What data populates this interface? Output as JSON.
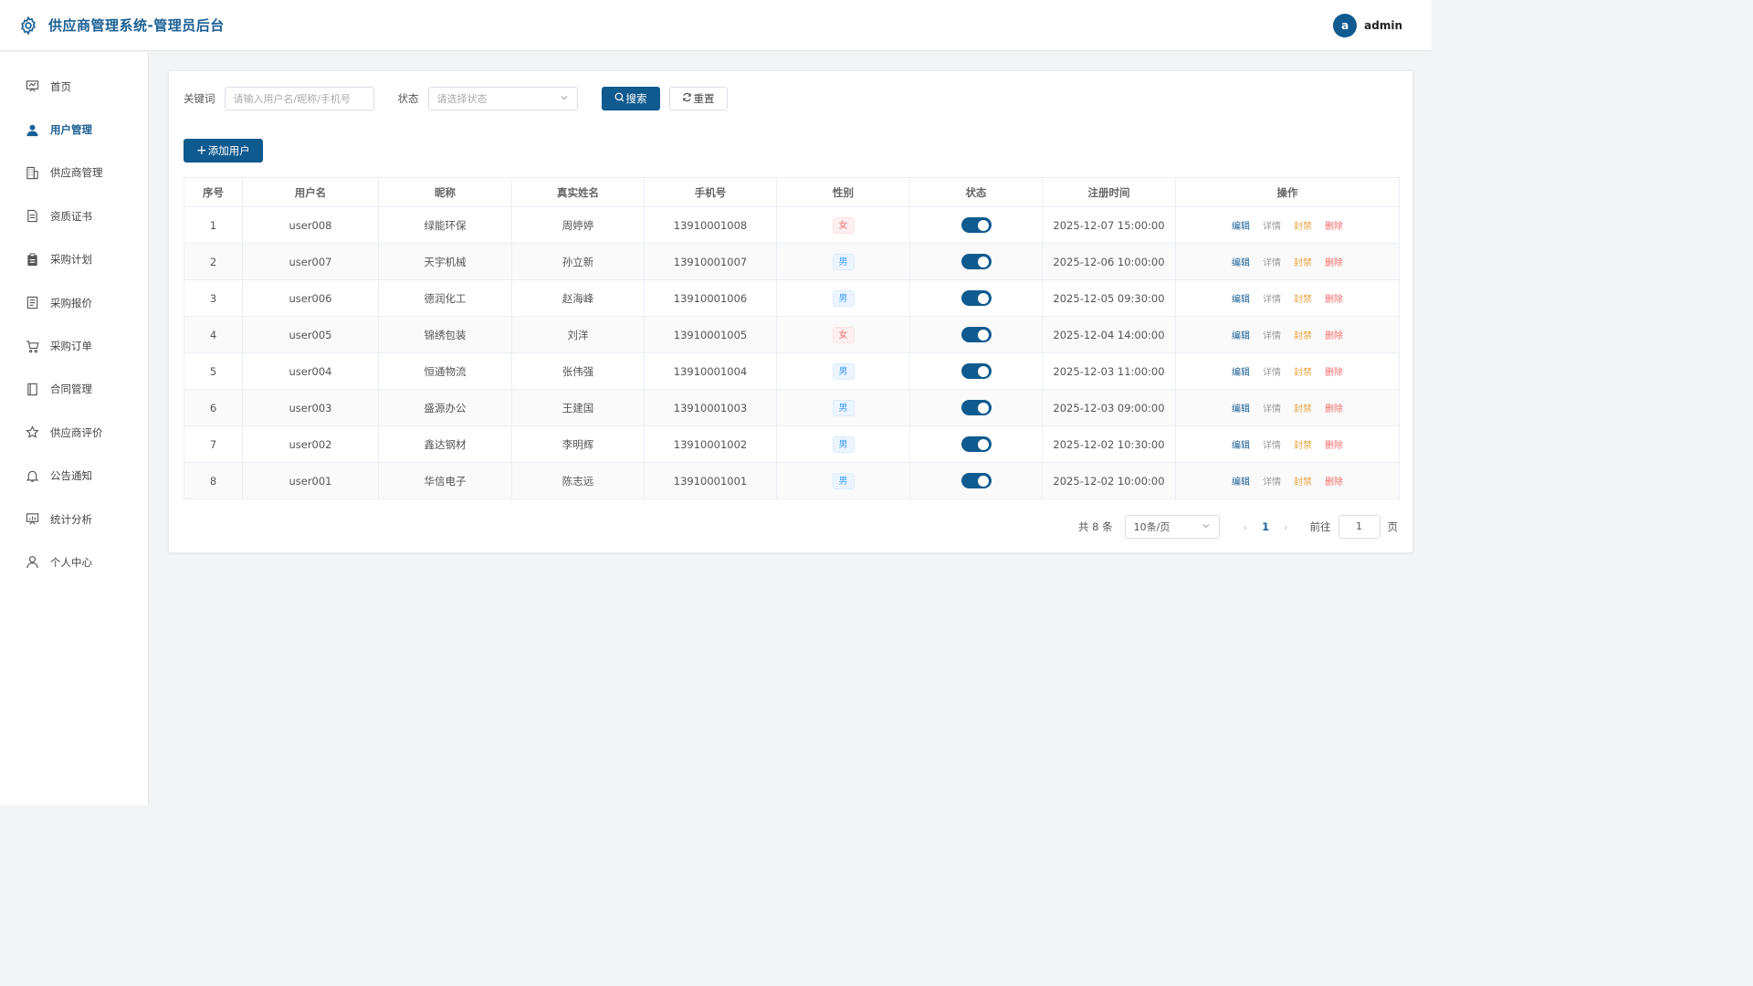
{
  "header": {
    "title": "供应商管理系统-管理员后台",
    "avatar_letter": "a",
    "username": "admin"
  },
  "sidebar": {
    "items": [
      {
        "label": "首页",
        "icon": "dashboard-icon"
      },
      {
        "label": "用户管理",
        "icon": "user-icon",
        "active": true
      },
      {
        "label": "供应商管理",
        "icon": "building-icon"
      },
      {
        "label": "资质证书",
        "icon": "document-icon"
      },
      {
        "label": "采购计划",
        "icon": "clipboard-icon"
      },
      {
        "label": "采购报价",
        "icon": "quote-icon"
      },
      {
        "label": "采购订单",
        "icon": "cart-icon"
      },
      {
        "label": "合同管理",
        "icon": "contract-icon"
      },
      {
        "label": "供应商评价",
        "icon": "star-icon"
      },
      {
        "label": "公告通知",
        "icon": "bell-icon"
      },
      {
        "label": "统计分析",
        "icon": "chart-icon"
      },
      {
        "label": "个人中心",
        "icon": "person-icon"
      }
    ]
  },
  "filter": {
    "keyword_label": "关键词",
    "keyword_placeholder": "请输入用户名/昵称/手机号",
    "status_label": "状态",
    "status_placeholder": "请选择状态",
    "search_label": "搜索",
    "reset_label": "重置"
  },
  "add_button": "添加用户",
  "table": {
    "columns": [
      "序号",
      "用户名",
      "昵称",
      "真实姓名",
      "手机号",
      "性别",
      "状态",
      "注册时间",
      "操作"
    ],
    "rows": [
      {
        "index": "1",
        "username": "user008",
        "nickname": "绿能环保",
        "realname": "周婷婷",
        "phone": "13910001008",
        "gender": "女",
        "enabled": true,
        "time": "2025-12-07 15:00:00"
      },
      {
        "index": "2",
        "username": "user007",
        "nickname": "天宇机械",
        "realname": "孙立新",
        "phone": "13910001007",
        "gender": "男",
        "enabled": true,
        "time": "2025-12-06 10:00:00"
      },
      {
        "index": "3",
        "username": "user006",
        "nickname": "德润化工",
        "realname": "赵海峰",
        "phone": "13910001006",
        "gender": "男",
        "enabled": true,
        "time": "2025-12-05 09:30:00"
      },
      {
        "index": "4",
        "username": "user005",
        "nickname": "锦绣包装",
        "realname": "刘洋",
        "phone": "13910001005",
        "gender": "女",
        "enabled": true,
        "time": "2025-12-04 14:00:00"
      },
      {
        "index": "5",
        "username": "user004",
        "nickname": "恒通物流",
        "realname": "张伟强",
        "phone": "13910001004",
        "gender": "男",
        "enabled": true,
        "time": "2025-12-03 11:00:00"
      },
      {
        "index": "6",
        "username": "user003",
        "nickname": "盛源办公",
        "realname": "王建国",
        "phone": "13910001003",
        "gender": "男",
        "enabled": true,
        "time": "2025-12-03 09:00:00"
      },
      {
        "index": "7",
        "username": "user002",
        "nickname": "鑫达钢材",
        "realname": "李明辉",
        "phone": "13910001002",
        "gender": "男",
        "enabled": true,
        "time": "2025-12-02 10:30:00"
      },
      {
        "index": "8",
        "username": "user001",
        "nickname": "华信电子",
        "realname": "陈志远",
        "phone": "13910001001",
        "gender": "男",
        "enabled": true,
        "time": "2025-12-02 10:00:00"
      }
    ],
    "actions": {
      "edit": "编辑",
      "detail": "详情",
      "ban": "封禁",
      "delete": "删除"
    }
  },
  "pagination": {
    "total_text": "共 8 条",
    "page_size": "10条/页",
    "current_page": "1",
    "goto_label": "前往",
    "goto_value": "1",
    "page_suffix": "页"
  },
  "colors": {
    "primary": "#0f5a8f",
    "female_tag": "#f56c6c",
    "male_tag": "#409eff",
    "ban": "#e6a23c",
    "delete": "#f56c6c"
  }
}
